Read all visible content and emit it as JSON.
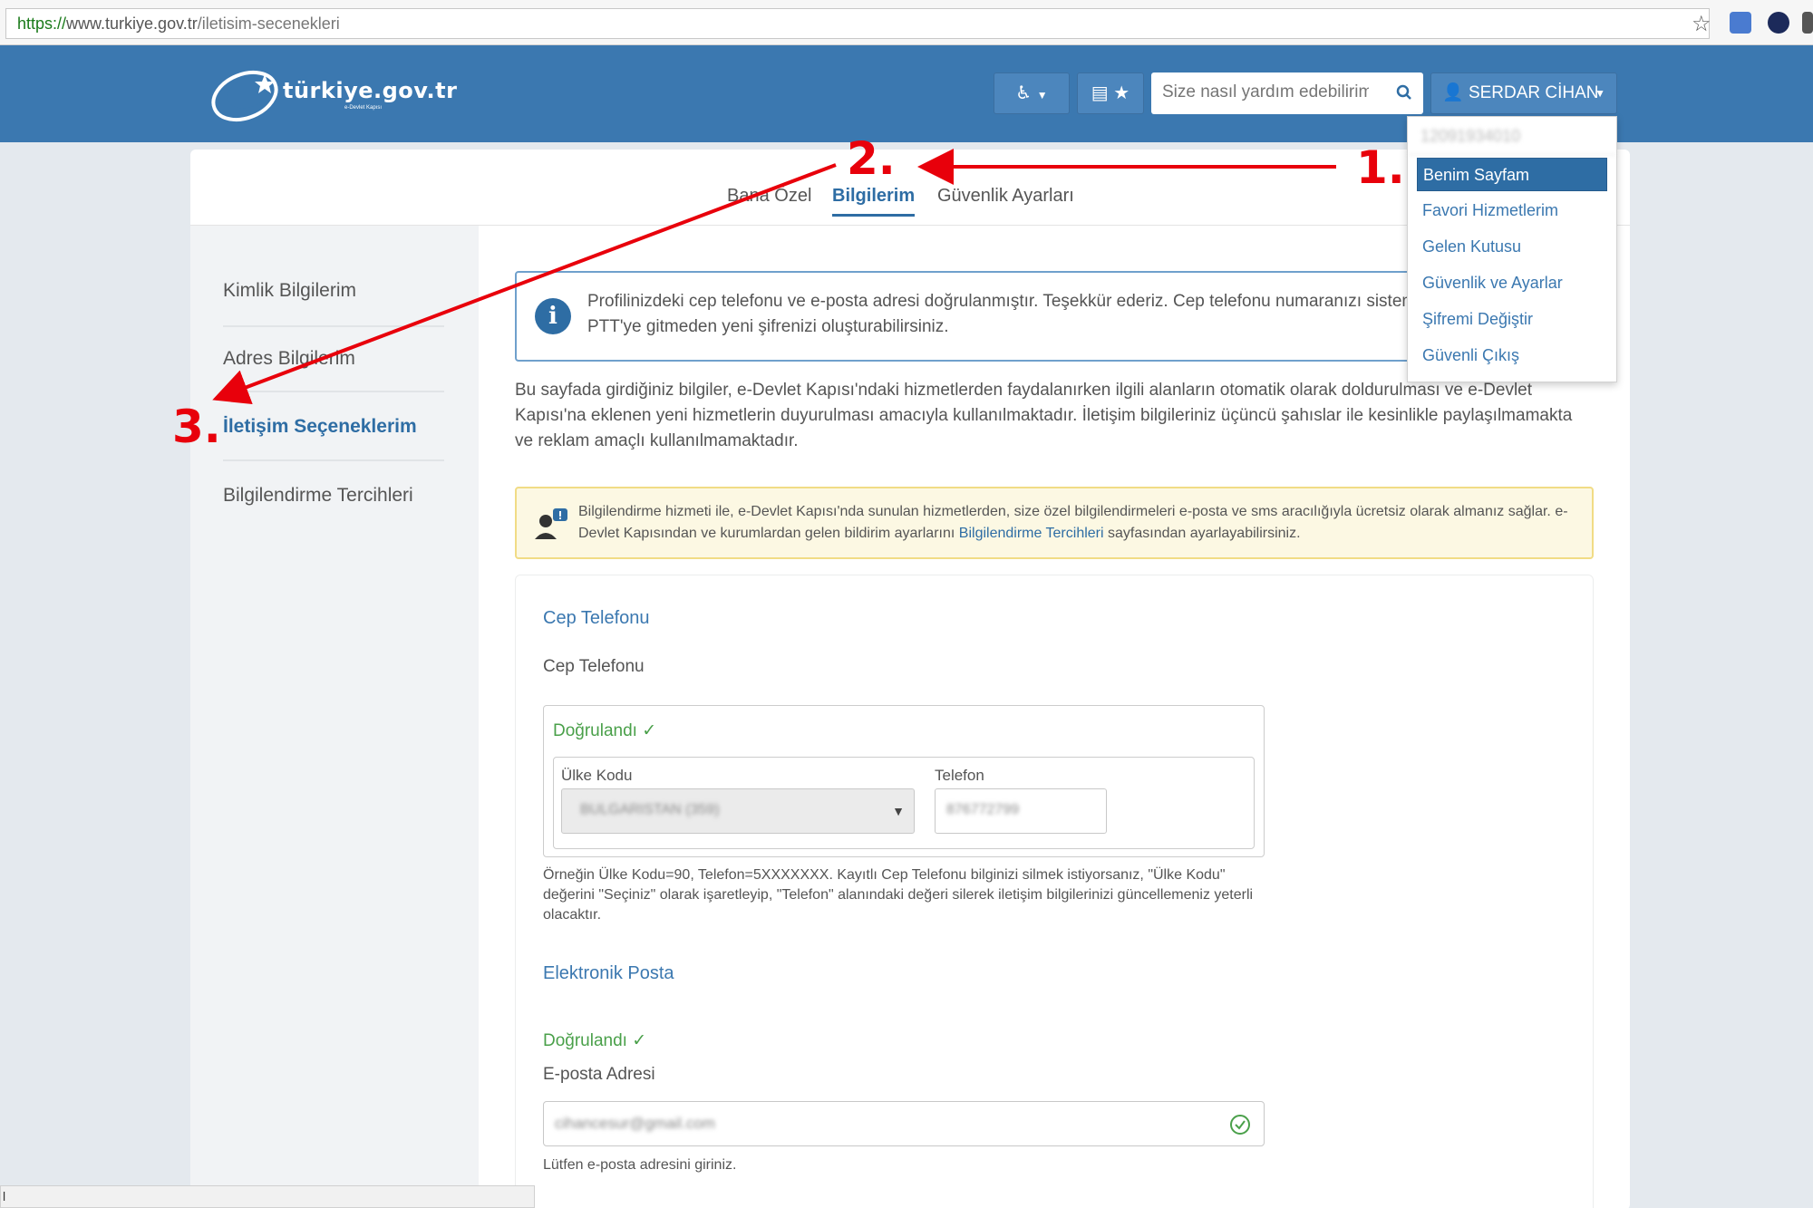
{
  "browser": {
    "url_scheme": "https://",
    "url_domain": "www.turkiye.gov.tr",
    "url_path": "/iletisim-secenekleri",
    "status_text": "l"
  },
  "header": {
    "logo_text": "türkiye.gov.tr",
    "logo_subtext": "e-Devlet Kapısı",
    "search_placeholder": "Size nasıl yardım edebilirim?",
    "user_name": "SERDAR CİHAN",
    "access_glyph": "♿",
    "card_glyph": "▤",
    "fav_glyph": "★"
  },
  "user_menu": {
    "id_number": "12091934010",
    "items": [
      "Benim Sayfam",
      "Favori Hizmetlerim",
      "Gelen Kutusu",
      "Güvenlik ve Ayarlar",
      "Şifremi Değiştir",
      "Güvenli Çıkış"
    ]
  },
  "top_tabs": [
    "Bana Özel",
    "Bilgilerim",
    "Güvenlik Ayarları"
  ],
  "sidebar": [
    "Kimlik Bilgilerim",
    "Adres Bilgilerim",
    "İletişim Seçeneklerim",
    "Bilgilendirme Tercihleri"
  ],
  "info_box": {
    "text": "Profilinizdeki cep telefonu ve e-posta adresi doğrulanmıştır. Teşekkür ederiz. Cep telefonu numaranızı sisteme kaydettiğiniz için PTT'ye gitmeden yeni şifrenizi oluşturabilirsiniz."
  },
  "description": "Bu sayfada girdiğiniz bilgiler, e-Devlet Kapısı'ndaki hizmetlerden faydalanırken ilgili alanların otomatik olarak doldurulması ve e-Devlet Kapısı'na eklenen yeni hizmetlerin duyurulması amacıyla kullanılmaktadır. İletişim bilgileriniz üçüncü şahıslar ile kesinlikle paylaşılmamakta ve reklam amaçlı kullanılmamaktadır.",
  "notice": {
    "text_before": "Bilgilendirme hizmeti ile, e-Devlet Kapısı'nda sunulan hizmetlerden, size özel bilgilendirmeleri e-posta ve sms aracılığıyla ücretsiz olarak almanız sağlar. e-Devlet Kapısından ve kurumlardan gelen bildirim ayarlarını",
    "link": "Bilgilendirme Tercihleri",
    "text_after": "sayfasından ayarlayabilirsiniz."
  },
  "phone_section": {
    "title": "Cep Telefonu",
    "label": "Cep Telefonu",
    "verified": "Doğrulandı ✓",
    "country_label": "Ülke Kodu",
    "country_value": "BULGARISTAN (359)",
    "phone_label": "Telefon",
    "phone_value": "876772799",
    "help": "Örneğin Ülke Kodu=90, Telefon=5XXXXXXX. Kayıtlı Cep Telefonu bilginizi silmek istiyorsanız, \"Ülke Kodu\" değerini \"Seçiniz\" olarak işaretleyip, \"Telefon\" alanındaki değeri silerek iletişim bilgilerinizi güncellemeniz yeterli olacaktır."
  },
  "email_section": {
    "title": "Elektronik Posta",
    "verified": "Doğrulandı ✓",
    "label": "E-posta Adresi",
    "value": "cihancesur@gmail.com",
    "help": "Lütfen e-posta adresini giriniz."
  },
  "annotations": [
    "1.",
    "2.",
    "3."
  ],
  "colors": {
    "header_blue": "#3b78b0",
    "link_blue": "#2e6da4",
    "annotation_red": "#e8000b",
    "verified_green": "#4aa04a"
  }
}
